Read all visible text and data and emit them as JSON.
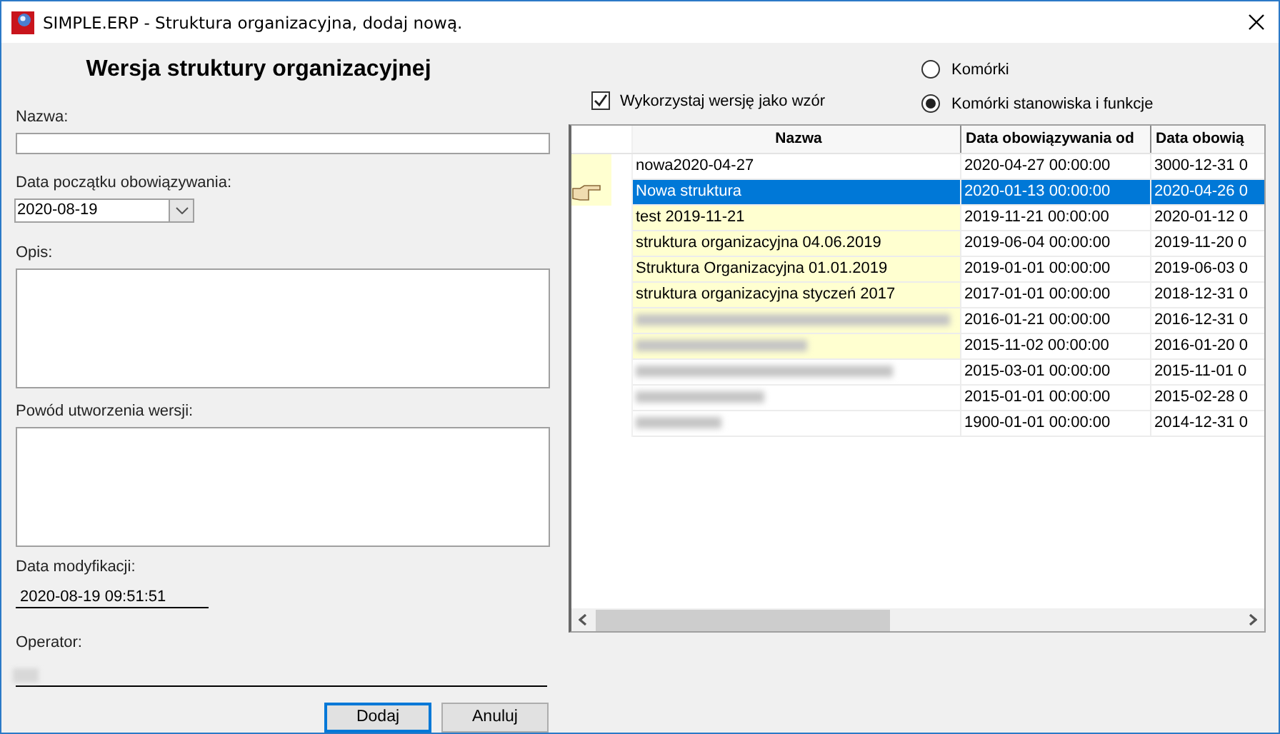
{
  "window": {
    "title": "SIMPLE.ERP - Struktura organizacyjna, dodaj nową."
  },
  "form": {
    "heading": "Wersja struktury organizacyjnej",
    "name": {
      "label": "Nazwa:"
    },
    "start_date": {
      "label": "Data początku obowiązywania:",
      "value": "2020-08-19"
    },
    "description": {
      "label": "Opis:"
    },
    "reason": {
      "label": "Powód utworzenia wersji:"
    },
    "modified": {
      "label": "Data modyfikacji:",
      "value": "2020-08-19 09:51:51"
    },
    "operator": {
      "label": "Operator:",
      "redacted": true
    }
  },
  "use_as_template": {
    "label": "Wykorzystaj wersję jako wzór",
    "checked": true
  },
  "scope": [
    {
      "label": "Komórki",
      "selected": false
    },
    {
      "label": "Komórki stanowiska i funkcje",
      "selected": true
    }
  ],
  "table": {
    "columns": [
      "Nazwa",
      "Data obowiązywania od",
      "Data obowią"
    ],
    "rows": [
      {
        "name": "nowa2020-04-27",
        "from": "2020-04-27 00:00:00",
        "to": "3000-12-31 0",
        "selected": false,
        "highlighted": false,
        "marker": true,
        "redacted": false
      },
      {
        "name": "Nowa struktura",
        "from": "2020-01-13 00:00:00",
        "to": "2020-04-26 0",
        "selected": true,
        "highlighted": false,
        "marker": true,
        "redacted": false
      },
      {
        "name": "test 2019-11-21",
        "from": "2019-11-21 00:00:00",
        "to": "2020-01-12 0",
        "selected": false,
        "highlighted": true,
        "marker": false,
        "redacted": false
      },
      {
        "name": "struktura organizacyjna 04.06.2019",
        "from": "2019-06-04 00:00:00",
        "to": "2019-11-20 0",
        "selected": false,
        "highlighted": true,
        "marker": false,
        "redacted": false
      },
      {
        "name": "Struktura Organizacyjna 01.01.2019",
        "from": "2019-01-01 00:00:00",
        "to": "2019-06-03 0",
        "selected": false,
        "highlighted": true,
        "marker": false,
        "redacted": false
      },
      {
        "name": "struktura organizacyjna styczeń 2017",
        "from": "2017-01-01 00:00:00",
        "to": "2018-12-31 0",
        "selected": false,
        "highlighted": true,
        "marker": false,
        "redacted": false
      },
      {
        "from": "2016-01-21 00:00:00",
        "to": "2016-12-31 0",
        "selected": false,
        "highlighted": true,
        "marker": false,
        "redacted": true
      },
      {
        "from": "2015-11-02 00:00:00",
        "to": "2016-01-20 0",
        "selected": false,
        "highlighted": true,
        "marker": false,
        "redacted": true
      },
      {
        "from": "2015-03-01 00:00:00",
        "to": "2015-11-01 0",
        "selected": false,
        "highlighted": false,
        "marker": false,
        "redacted": true
      },
      {
        "from": "2015-01-01 00:00:00",
        "to": "2015-02-28 0",
        "selected": false,
        "highlighted": false,
        "marker": false,
        "redacted": true
      },
      {
        "from": "1900-01-01 00:00:00",
        "to": "2014-12-31 0",
        "selected": false,
        "highlighted": false,
        "marker": false,
        "redacted": true
      }
    ]
  },
  "buttons": [
    {
      "label": "Dodaj",
      "default": true
    },
    {
      "label": "Anuluj",
      "default": false
    }
  ]
}
